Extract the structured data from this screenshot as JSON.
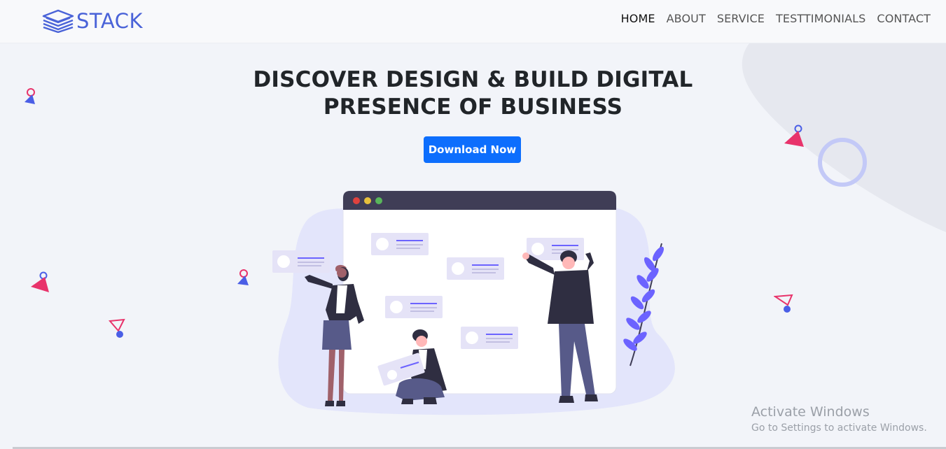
{
  "brand": {
    "name": "STACK",
    "icon": "stack-layers-icon",
    "color": "#4a63d8"
  },
  "nav": {
    "items": [
      {
        "label": "HOME",
        "active": true
      },
      {
        "label": "ABOUT",
        "active": false
      },
      {
        "label": "SERVICE",
        "active": false
      },
      {
        "label": "TESTTIMONIALS",
        "active": false
      },
      {
        "label": "CONTACT",
        "active": false
      }
    ]
  },
  "hero": {
    "title_line1": "DISCOVER DESIGN & BUILD DIGITAL",
    "title_line2": "PRESENCE OF BUSINESS",
    "cta_label": "Download Now",
    "cta_color": "#0d6efd"
  },
  "illustration": {
    "icon": "team-building-website-illustration"
  },
  "windows_watermark": {
    "title": "Activate Windows",
    "subtitle": "Go to Settings to activate Windows."
  },
  "colors": {
    "accent_pink": "#e8336b",
    "accent_blue": "#4a5ee6",
    "ring": "#c3c9f7"
  }
}
